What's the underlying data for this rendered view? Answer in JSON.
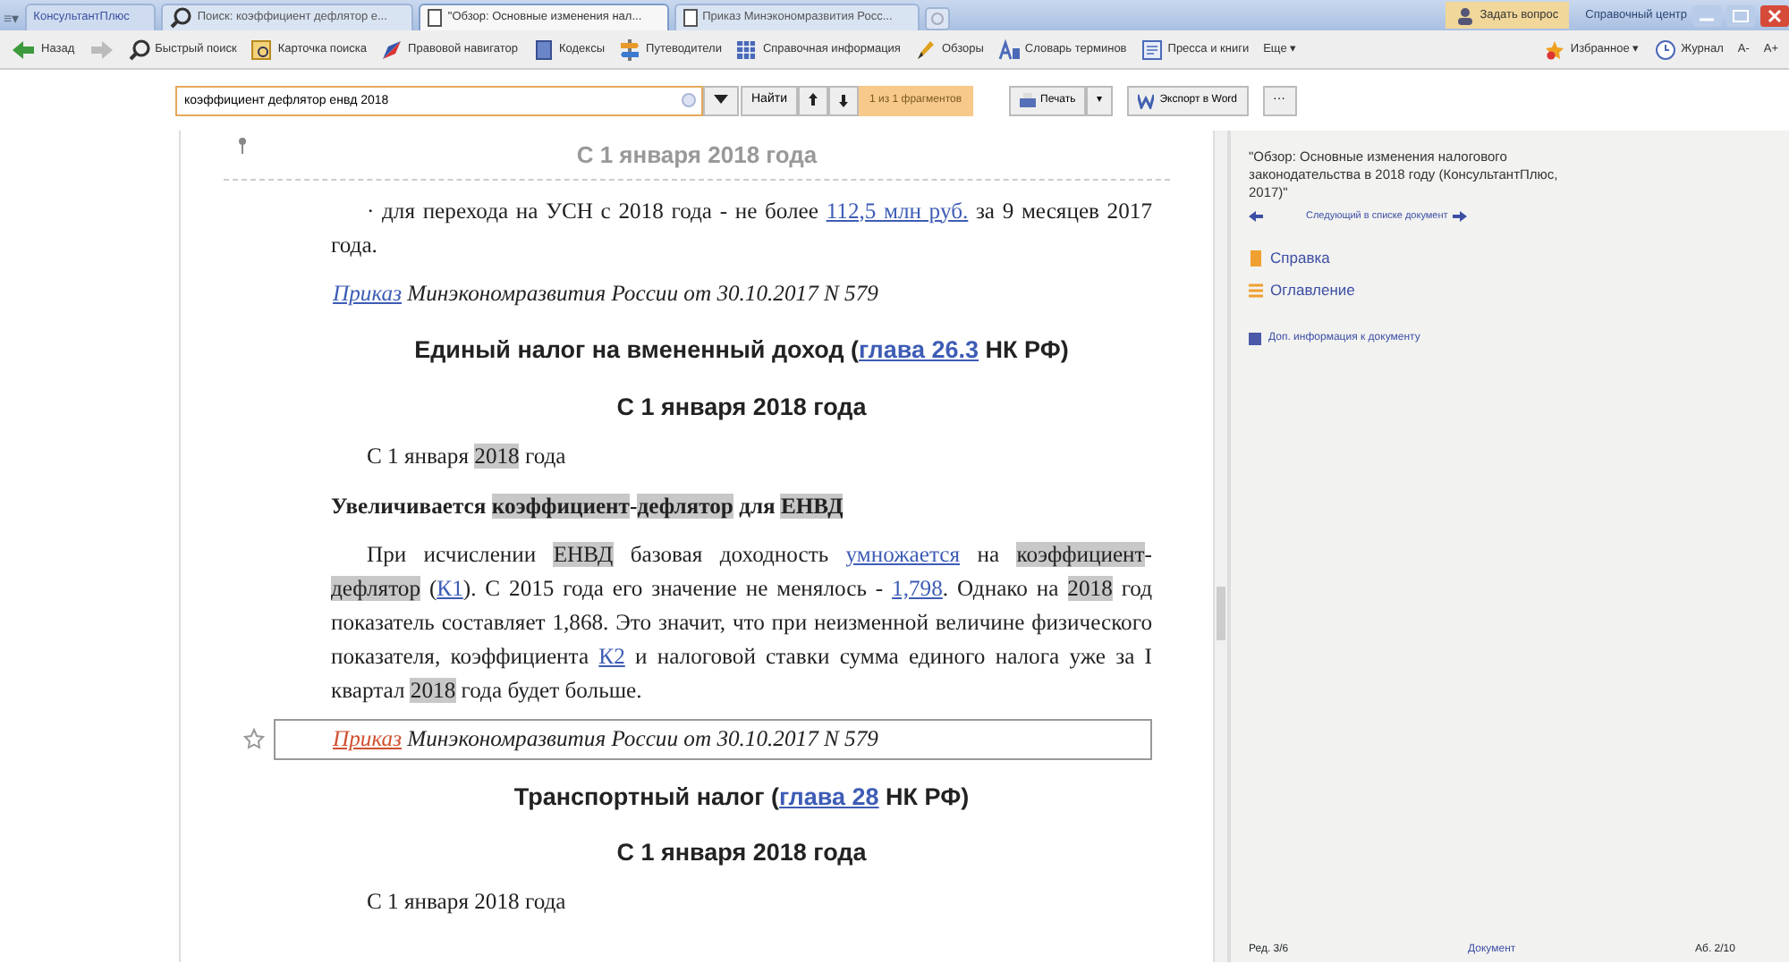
{
  "tabs": [
    {
      "label": "КонсультантПлюс",
      "kind": "home",
      "selected": false
    },
    {
      "label": "Поиск: коэффициент дефлятор е...",
      "kind": "search",
      "selected": false
    },
    {
      "label": "\"Обзор: Основные изменения нал...",
      "kind": "doc",
      "selected": true
    },
    {
      "label": "Приказ Минэкономразвития Росс...",
      "kind": "doc",
      "selected": false
    }
  ],
  "title_actions": {
    "ask": "Задать вопрос",
    "help": "Справочный центр"
  },
  "menu": "≡▾",
  "toolbar": [
    {
      "label": "Назад"
    },
    {
      "label": "Быстрый поиск"
    },
    {
      "label": "Карточка поиска"
    },
    {
      "label": "Правовой навигатор"
    },
    {
      "label": "Кодексы"
    },
    {
      "label": "Путеводители"
    },
    {
      "label": "Справочная информация"
    },
    {
      "label": "Обзоры"
    },
    {
      "label": "Словарь терминов"
    },
    {
      "label": "Пресса и книги"
    },
    {
      "label": "Еще ▾"
    }
  ],
  "toolbar_right": [
    {
      "label": "Избранное ▾"
    },
    {
      "label": "Журнал"
    },
    {
      "label": "А-"
    },
    {
      "label": "А+"
    }
  ],
  "search": {
    "value": "коэффициент дефлятор енвд 2018",
    "find": "Найти",
    "count": "1 из 1 фрагментов",
    "print": "Печать",
    "print_menu": "▾",
    "export": "Экспорт в Word",
    "more": "···"
  },
  "document": [
    {
      "kind": "sticky",
      "segments": [
        {
          "kind": "text",
          "text": "С 1 января 2018 года"
        }
      ]
    },
    {
      "kind": "para",
      "segments": [
        {
          "kind": "text",
          "text": "· для перехода на УСН с 2018 года - не более "
        },
        {
          "kind": "link",
          "text": "112,5 млн руб."
        },
        {
          "kind": "text",
          "text": " за 9 месяцев 2017 года."
        }
      ]
    },
    {
      "kind": "ref",
      "current": false,
      "segments": [
        {
          "kind": "link",
          "text": "Приказ"
        },
        {
          "kind": "text",
          "text": " Минэкономразвития России от 30.10.2017 N 579"
        }
      ]
    },
    {
      "kind": "heading",
      "segments": [
        {
          "kind": "text",
          "text": "Единый налог на вмененный доход ("
        },
        {
          "kind": "link",
          "text": "глава 26.3"
        },
        {
          "kind": "text",
          "text": " НК РФ)"
        }
      ]
    },
    {
      "kind": "heading",
      "segments": [
        {
          "kind": "text",
          "text": "С 1 января 2018 года"
        }
      ]
    },
    {
      "kind": "para",
      "segments": [
        {
          "kind": "text",
          "text": "С 1 января "
        },
        {
          "kind": "match",
          "text": "2018"
        },
        {
          "kind": "text",
          "text": " года"
        }
      ]
    },
    {
      "kind": "bold",
      "segments": [
        {
          "kind": "text",
          "text": "Увеличивается "
        },
        {
          "kind": "match",
          "text": "коэффициент"
        },
        {
          "kind": "text",
          "text": "-"
        },
        {
          "kind": "match",
          "text": "дефлятор"
        },
        {
          "kind": "text",
          "text": " для "
        },
        {
          "kind": "match",
          "text": "ЕНВД"
        }
      ]
    },
    {
      "kind": "para",
      "segments": [
        {
          "kind": "text",
          "text": "При исчислении "
        },
        {
          "kind": "match",
          "text": "ЕНВД"
        },
        {
          "kind": "text",
          "text": " базовая доходность "
        },
        {
          "kind": "link",
          "text": "умножается"
        },
        {
          "kind": "text",
          "text": " на "
        },
        {
          "kind": "match",
          "text": "коэффициент"
        },
        {
          "kind": "text",
          "text": "-"
        },
        {
          "kind": "match",
          "text": "дефлятор"
        },
        {
          "kind": "text",
          "text": " ("
        },
        {
          "kind": "link",
          "text": "К1"
        },
        {
          "kind": "text",
          "text": "). С 2015 года его значение не менялось - "
        },
        {
          "kind": "link",
          "text": "1,798"
        },
        {
          "kind": "text",
          "text": ". Однако на "
        },
        {
          "kind": "match",
          "text": "2018"
        },
        {
          "kind": "text",
          "text": " год показатель составляет 1,868. Это значит, что при неизменной величине физического показателя, коэффициента "
        },
        {
          "kind": "link",
          "text": "К2"
        },
        {
          "kind": "text",
          "text": " и налоговой ставки сумма единого налога уже за I квартал "
        },
        {
          "kind": "match",
          "text": "2018"
        },
        {
          "kind": "text",
          "text": " года будет больше."
        }
      ]
    },
    {
      "kind": "ref",
      "current": true,
      "segments": [
        {
          "kind": "visited",
          "text": "Приказ"
        },
        {
          "kind": "text",
          "text": " Минэкономразвития России от 30.10.2017 N 579"
        }
      ]
    },
    {
      "kind": "heading",
      "segments": [
        {
          "kind": "text",
          "text": "Транспортный налог ("
        },
        {
          "kind": "link",
          "text": "глава 28"
        },
        {
          "kind": "text",
          "text": " НК РФ)"
        }
      ]
    },
    {
      "kind": "heading",
      "segments": [
        {
          "kind": "text",
          "text": "С 1 января 2018 года"
        }
      ]
    },
    {
      "kind": "para",
      "segments": [
        {
          "kind": "text",
          "text": "С 1 января 2018 года"
        }
      ]
    }
  ],
  "panel": {
    "title": "\"Обзор: Основные изменения налогового законодательства в 2018 году (КонсультантПлюс, 2017)\"",
    "next": "Следующий в списке документ",
    "links": [
      {
        "label": "Справка"
      },
      {
        "label": "Оглавление"
      }
    ],
    "info": "Доп. информация к документу",
    "footer": [
      "Ред. 3/6",
      "Документ",
      "Аб. 2/10"
    ]
  }
}
